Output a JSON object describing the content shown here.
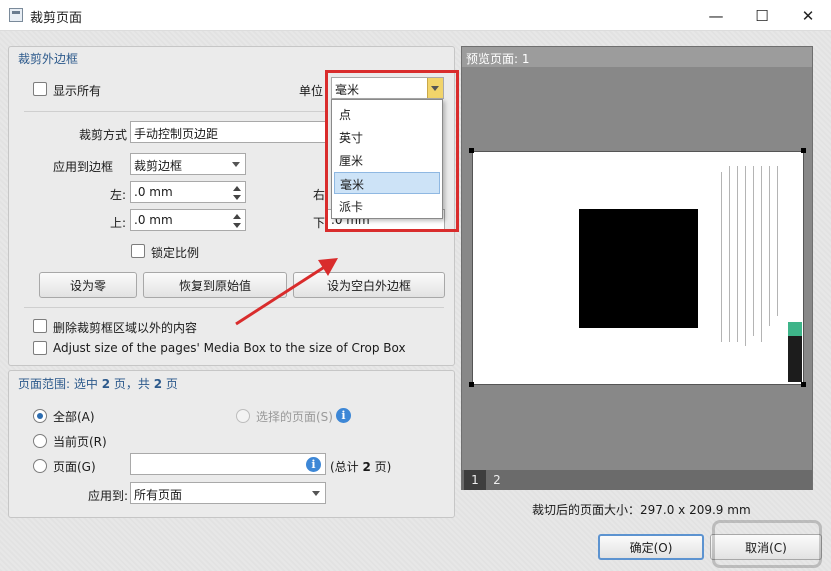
{
  "window": {
    "title": "裁剪页面",
    "minimize": "—",
    "maximize": "☐",
    "close": "✕"
  },
  "crop_margins": {
    "header": "裁剪外边框",
    "show_all_label": "显示所有",
    "unit_label": "单位",
    "unit_value": "毫米",
    "unit_options": [
      "点",
      "英寸",
      "厘米",
      "毫米",
      "派卡"
    ],
    "unit_selected_index": 3,
    "crop_mode_label": "裁剪方式",
    "crop_mode_value": "手动控制页边距",
    "apply_label": "应用到边框",
    "apply_value": "裁剪边框",
    "left_label": "左:",
    "left_value": ".0 mm",
    "right_label": "右",
    "top_label": "上:",
    "top_value": ".0 mm",
    "bottom_label": "下",
    "bottom_value": ".0 mm",
    "lock_ratio_label": "锁定比例",
    "set_zero_button": "设为零",
    "restore_button": "恢复到原始值",
    "set_blank_button": "设为空白外边框",
    "delete_outside_label": "删除裁剪框区域以外的内容",
    "adjust_media_label": "Adjust size of the pages' Media Box to the size of Crop Box"
  },
  "page_range": {
    "header_prefix": "页面范围: 选中 ",
    "selected": "2",
    "header_mid": " 页，共 ",
    "total": "2",
    "header_suffix": " 页",
    "all_label": "全部(A)",
    "selected_pages_label": "选择的页面(S)",
    "current_label": "当前页(R)",
    "pages_label": "页面(G)",
    "pages_value": "",
    "total_prefix": "(总计 ",
    "total_value": "2",
    "total_suffix": " 页)",
    "apply_to_label": "应用到:",
    "apply_to_value": "所有页面"
  },
  "preview": {
    "header": "预览页面: 1",
    "thumbs": [
      "1",
      "2"
    ],
    "size_text": "裁切后的页面大小：297.0 x 209.9 mm"
  },
  "footer": {
    "ok_button": "确定(O)",
    "cancel_button": "取消(C)"
  },
  "colors": {
    "highlight": "#d92c2c",
    "header_text": "#2d5a8c",
    "accent": "#2c6cb0"
  }
}
